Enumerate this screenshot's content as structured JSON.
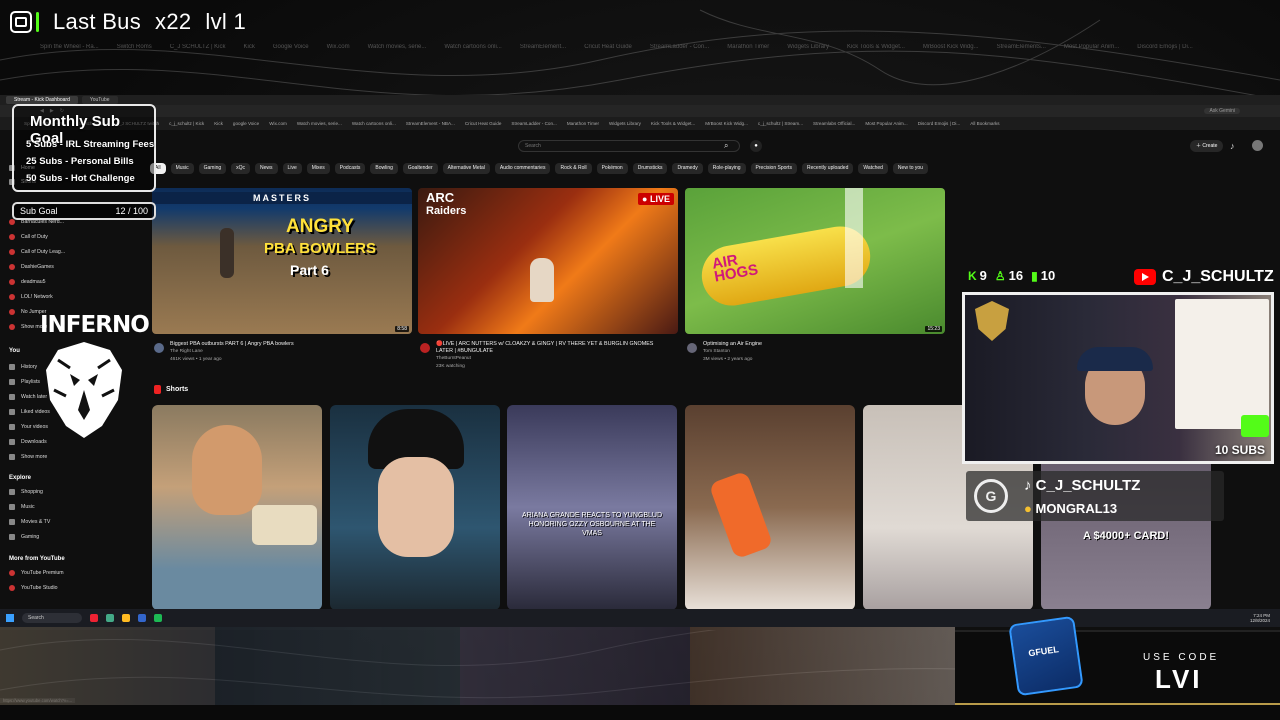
{
  "overlay_top": {
    "title": "Last Bus",
    "multiplier": "x22",
    "level": "lvl 1"
  },
  "background_bookmarks": [
    "Spin the Wheel - Ra...",
    "Switch Roms",
    "C_J SCHULTZ | Kick",
    "Kick",
    "Google Voice",
    "Wix.com",
    "Watch movies, serie...",
    "Watch cartoons onli...",
    "StreamElement...",
    "Cricut Heat Guide",
    "StreamLadder - Con...",
    "Marathon Timer",
    "Widgets Library",
    "Kick Tools & Widget...",
    "MrBoost Kick Widg...",
    "StreamElements...",
    "Most Popular Anim...",
    "Discord Emojis | Di..."
  ],
  "browser": {
    "tabs": [
      "Stream - Kick Dashboard",
      "YouTube"
    ],
    "ask_label": "Ask Gemini",
    "bookmarks": [
      "Spin the Wheel - Ra...",
      "Switch Roms",
      "C_J SCHULTZ twitch",
      "c_j_schultz | Kick",
      "Kick",
      "google Voice",
      "Wix.com",
      "Watch movies, serie...",
      "Watch cartoons onli...",
      "StreamElement - NBA...",
      "Cricut Heat Guide",
      "StreamLadder - Con...",
      "Marathon Timer",
      "Widgets Library",
      "Kick Tools & Widget...",
      "MrBoost Kick Widg...",
      "c_j_schultz | Stream...",
      "Streamlabs Official...",
      "Most Popular Anim...",
      "Discord Emojis | Di...",
      "All Bookmarks"
    ]
  },
  "youtube": {
    "search_placeholder": "Search",
    "create_label": "Create",
    "chips": [
      "All",
      "Music",
      "Gaming",
      "xQc",
      "News",
      "Live",
      "Mixes",
      "Podcasts",
      "Bowling",
      "Goaltender",
      "Alternative Metal",
      "Audio commentaries",
      "Rock & Roll",
      "Pokémon",
      "Drumsticks",
      "Dramedy",
      "Role-playing",
      "Precision Sports",
      "Recently uploaded",
      "Watched",
      "New to you"
    ],
    "sidebar": {
      "top": [
        "Home",
        "Shorts"
      ],
      "subscriptions": [
        "Barnacules Nerd...",
        "Call of Duty",
        "Call of Duty Leag...",
        "DashieGames",
        "deadmau5",
        "LOL! Network",
        "No Jumper",
        "Show more"
      ],
      "you_label": "You",
      "you_items": [
        "History",
        "Playlists",
        "Watch later",
        "Liked videos",
        "Your videos",
        "Downloads",
        "Show more"
      ],
      "explore_label": "Explore",
      "explore_items": [
        "Shopping",
        "Music",
        "Movies & TV",
        "Gaming"
      ],
      "more_label": "More from YouTube",
      "more_items": [
        "YouTube Premium",
        "YouTube Studio"
      ]
    },
    "videos": [
      {
        "title": "Biggest PBA outbursts PART 6 | Angry PBA bowlers",
        "channel": "The Right Lane",
        "meta": "461K views • 1 year ago",
        "duration": "8:58",
        "thumb_text": [
          "ANGRY",
          "PBA BOWLERS",
          "Part 6"
        ],
        "banner": "MASTERS"
      },
      {
        "title": "🔴LIVE | ARC NUTTERS w/ CLOAKZY & GINGY | RV THERE YET & BURGLIN GNOMES LATER | #BUNGULATE",
        "channel": "TheBurntPeanut",
        "meta": "23K watching",
        "live_badge": "LIVE",
        "thumb_text": [
          "ARC",
          "Raiders"
        ]
      },
      {
        "title": "Optimising an Air Engine",
        "channel": "Tom Stanton",
        "meta": "3M views • 2 years ago",
        "duration": "15:23",
        "thumb_text": [
          "AIR",
          "HOGS"
        ]
      }
    ],
    "shorts_label": "Shorts",
    "shorts_captions": [
      "",
      "",
      "ARIANA GRANDE REACTS TO YUNGBLUD HONORING OZZY OSBOURNE AT THE VMAS",
      "",
      "",
      "A $4000+ CARD!"
    ],
    "status_url": "https://www.youtube.com/watch?v=..."
  },
  "taskbar": {
    "search": "Search",
    "time": "7:24 PM",
    "date": "12/8/2024"
  },
  "goal_overlay": {
    "title": "Monthly Sub Goal",
    "lines": [
      "5 Subs - IRL Streaming Fees",
      "25 Subs - Personal Bills",
      "50 Subs - Hot Challenge"
    ],
    "sub_goal_label": "Sub Goal",
    "sub_goal_count": "12 / 100"
  },
  "team_logo_text": "INFERNO",
  "stream_stats": {
    "followers": "9",
    "viewers": "16",
    "chatters": "10"
  },
  "channel_name": "C_J_SCHULTZ",
  "webcam": {
    "subs_label": "10 SUBS"
  },
  "credits": {
    "line1": "C_J_SCHULTZ",
    "line2": "MONGRAL13"
  },
  "promo": {
    "line1": "USE CODE",
    "line2": "LVI",
    "product": "GFUEL"
  },
  "colors": {
    "kick_green": "#53fc18",
    "youtube_red": "#ff0000",
    "gold": "#b89b4a"
  }
}
